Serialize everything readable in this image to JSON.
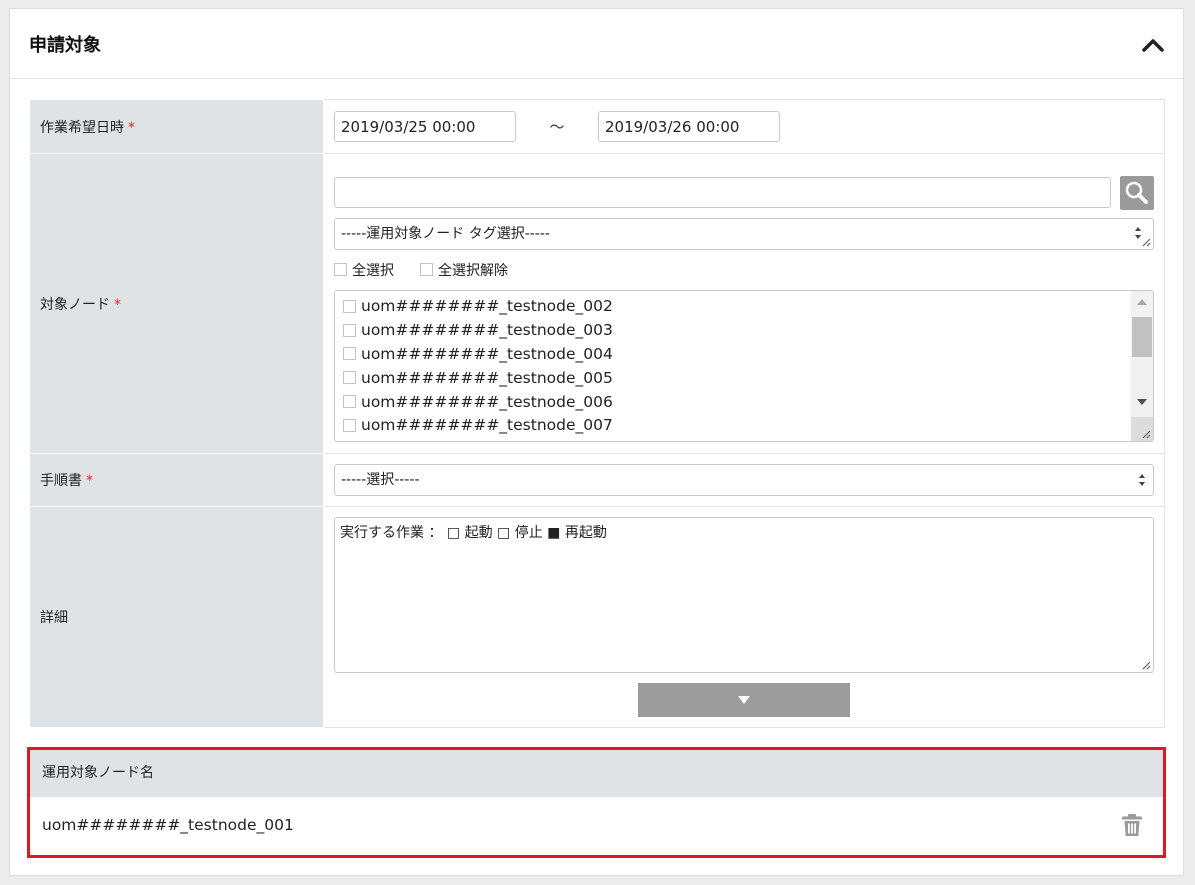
{
  "panel": {
    "title": "申請対象"
  },
  "form": {
    "schedule": {
      "label": "作業希望日時",
      "required_mark": "*",
      "start": "2019/03/25 00:00",
      "separator": "～",
      "end": "2019/03/26 00:00"
    },
    "nodes": {
      "label": "対象ノード",
      "required_mark": "*",
      "search_value": "",
      "tag_select": "-----運用対象ノード タグ選択-----",
      "select_all": "全選択",
      "deselect_all": "全選択解除",
      "items": [
        "uom########_testnode_002",
        "uom########_testnode_003",
        "uom########_testnode_004",
        "uom########_testnode_005",
        "uom########_testnode_006",
        "uom########_testnode_007"
      ]
    },
    "procedure": {
      "label": "手順書",
      "required_mark": "*",
      "selected": "-----選択-----"
    },
    "detail": {
      "label": "詳細",
      "text": "実行する作業 ： □ 起動 □ 停止 ■ 再起動"
    }
  },
  "selected_nodes": {
    "header": "運用対象ノード名",
    "rows": [
      "uom########_testnode_001"
    ]
  },
  "colors": {
    "label_bg": "#dfe3e6",
    "required": "#e0242b",
    "highlight_border": "#e0181f",
    "button_gray": "#9c9c9c"
  },
  "icons": [
    "chevron-up-icon",
    "search-icon",
    "select-arrows-icon",
    "resize-grip-icon",
    "caret-down-icon",
    "trash-icon"
  ]
}
